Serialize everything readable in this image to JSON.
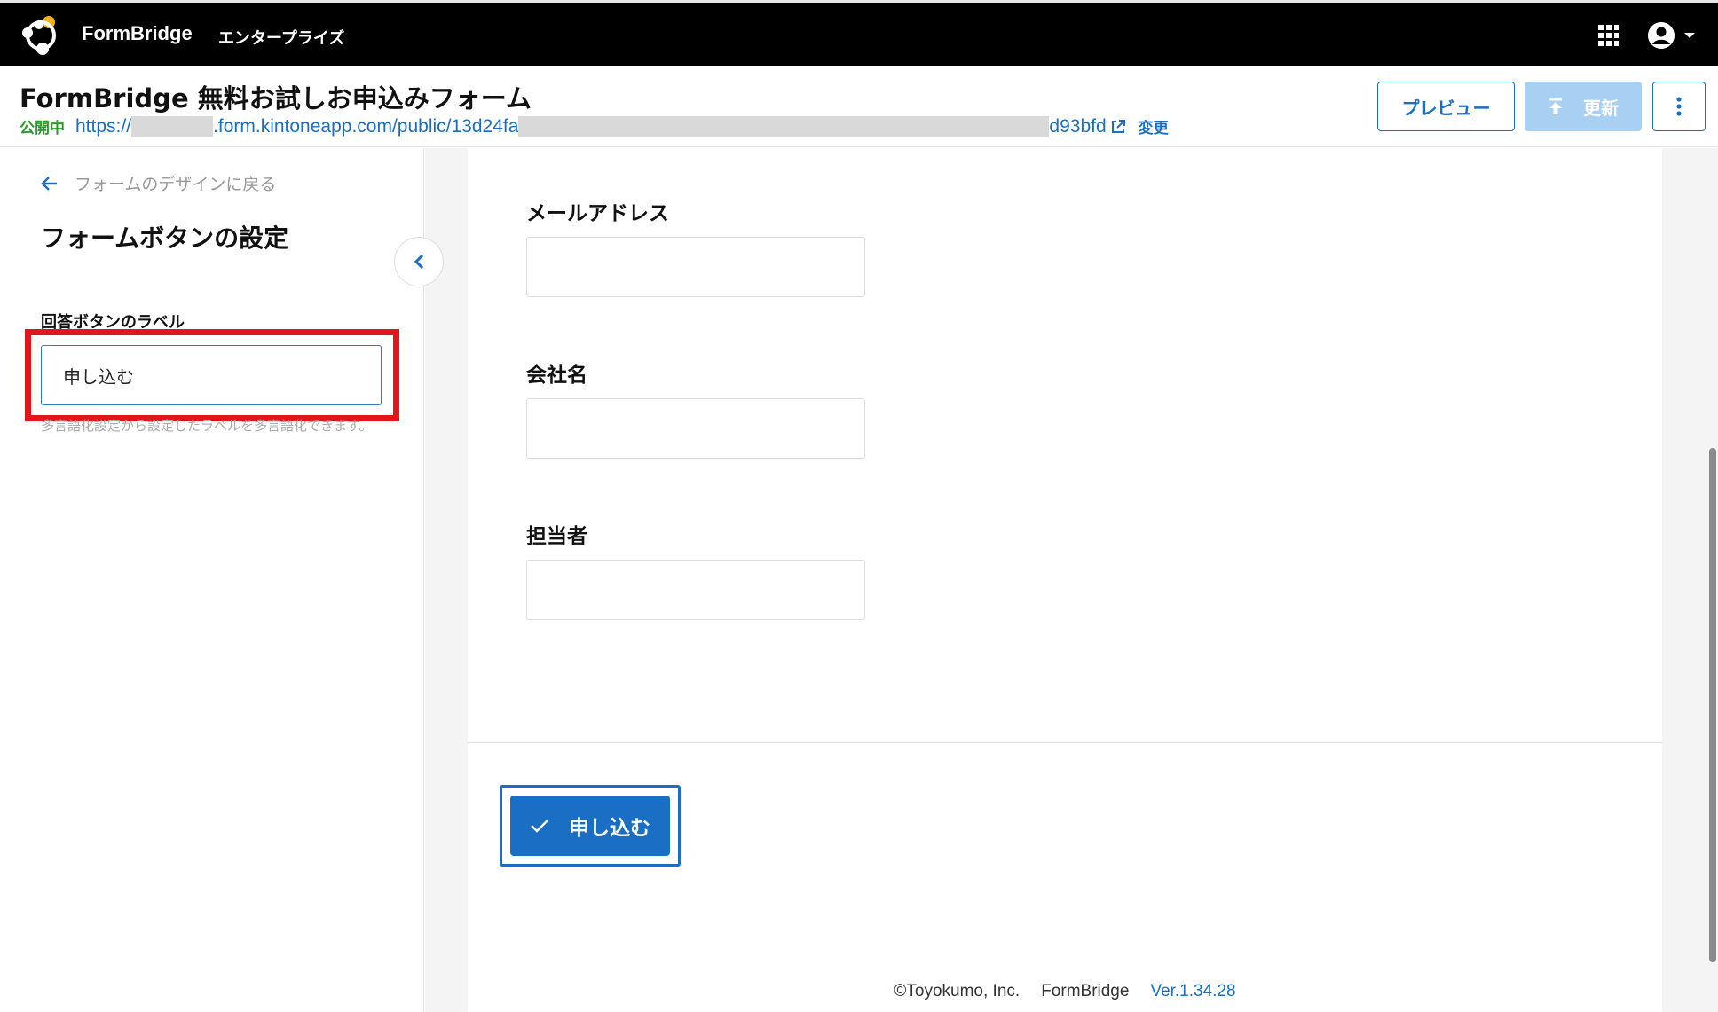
{
  "app": {
    "brand": "FormBridge",
    "edition": "エンタープライズ"
  },
  "header": {
    "title": "FormBridge 無料お試しお申込みフォーム",
    "status": "公開中",
    "url_prefix": "https://",
    "url_middle": ".form.kintoneapp.com/public/13d24fa",
    "url_suffix": "d93bfd",
    "change_label": "変更",
    "preview_label": "プレビュー",
    "update_label": "更新"
  },
  "sidebar": {
    "back_label": "フォームのデザインに戻る",
    "title": "フォームボタンの設定",
    "field_label": "回答ボタンのラベル",
    "input_value": "申し込む",
    "help_text": "多言語化設定から設定したラベルを多言語化できます。"
  },
  "form": {
    "fields": [
      {
        "label": "メールアドレス"
      },
      {
        "label": "会社名"
      },
      {
        "label": "担当者"
      }
    ],
    "submit_label": "申し込む"
  },
  "footer": {
    "copyright": "©Toyokumo, Inc.",
    "product": "FormBridge",
    "version": "Ver.1.34.28"
  },
  "colors": {
    "accent": "#1a6fc4",
    "highlight": "#e0161b",
    "status_green": "#2a9b2a"
  }
}
